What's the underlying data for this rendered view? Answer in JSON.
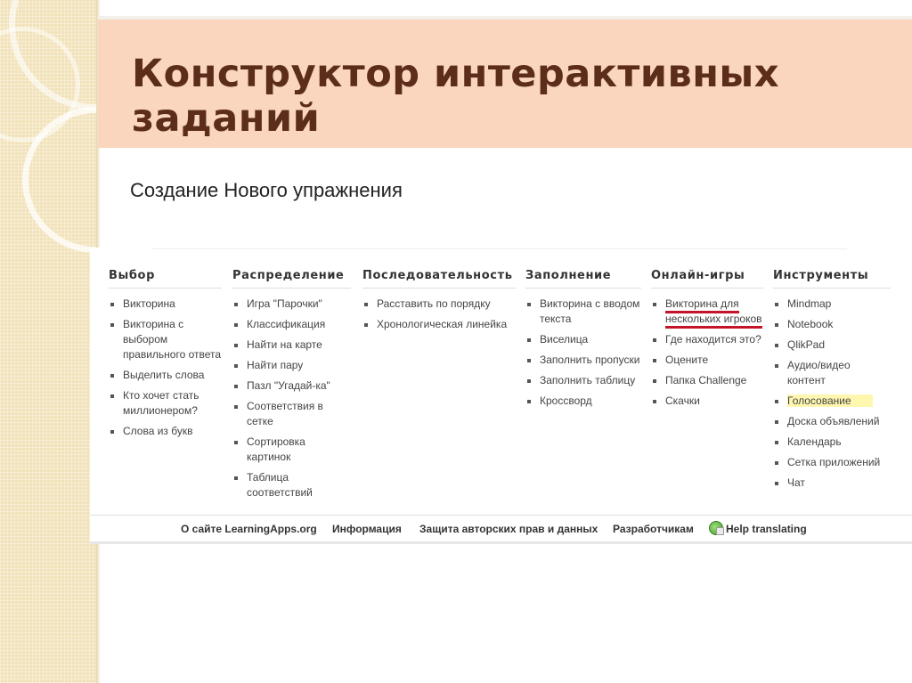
{
  "slide": {
    "title": "Конструктор интерактивных заданий",
    "subtitle": "Создание Нового упражнения"
  },
  "columns": [
    {
      "heading": "Выбор",
      "items": [
        "Викторина",
        "Викторина с выбором правильного ответа",
        "Выделить слова",
        "Кто хочет стать миллионером?",
        "Слова из букв"
      ]
    },
    {
      "heading": "Распределение",
      "items": [
        "Игра \"Парочки\"",
        "Классификация",
        "Найти на карте",
        "Найти пару",
        "Пазл \"Угадай-ка\"",
        "Соответствия в сетке",
        "Сортировка картинок",
        "Таблица соответствий"
      ]
    },
    {
      "heading": "Последовательность",
      "items": [
        "Расставить по порядку",
        "Хронологическая линейка"
      ]
    },
    {
      "heading": "Заполнение",
      "items": [
        "Викторина с вводом текста",
        "Виселица",
        "Заполнить пропуски",
        "Заполнить таблицу",
        "Кроссворд"
      ]
    },
    {
      "heading": "Онлайн-игры",
      "items": [
        "Викторина для нескольких игроков",
        "Где находится это?",
        "Оцените",
        "Папка Challenge",
        "Скачки"
      ]
    },
    {
      "heading": "Инструменты",
      "items": [
        "Mindmap",
        "Notebook",
        "QlikPad",
        "Аудио/видео контент",
        "Голосование",
        "Доска объявлений",
        "Календарь",
        "Сетка приложений",
        "Чат"
      ]
    }
  ],
  "footer": {
    "links": [
      "О сайте LearningApps.org",
      "Информация",
      "Защита авторских прав и данных",
      "Разработчикам",
      "Help translating"
    ]
  },
  "highlight": {
    "highlighted_item": "Голосование",
    "underlined_item": "Викторина для нескольких игроков",
    "highlight_color": "#fff7b0",
    "underline_color": "#c4142a"
  },
  "colors": {
    "title_band": "#f9d6bd",
    "title_text": "#5b2d1a",
    "left_strip": "#f1e2b9"
  }
}
